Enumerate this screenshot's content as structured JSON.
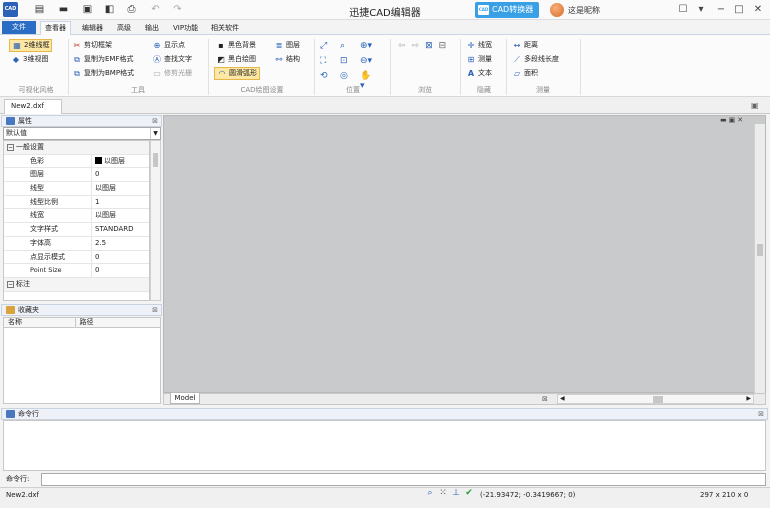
{
  "title_bar": {
    "logo_text": "CAD",
    "app_title": "迅捷CAD编辑器",
    "convert_button_label": "CAD转换器",
    "convert_icon_text": "CAD",
    "user_name": "这是昵称",
    "quick_access_icons": [
      "new-doc-icon",
      "open-folder-icon",
      "save-icon",
      "export-icon",
      "print-icon",
      "undo-icon",
      "redo-icon"
    ],
    "window_controls": [
      "feedback-icon",
      "skin-icon",
      "minimize-icon",
      "maximize-icon",
      "close-icon"
    ]
  },
  "menu": {
    "file": "文件",
    "tabs": [
      "查看器",
      "编辑器",
      "高级",
      "输出",
      "VIP功能",
      "相关软件"
    ],
    "active_tab": "查看器"
  },
  "ribbon": {
    "groups": [
      {
        "label": "可视化风格",
        "items": [
          "2维线框",
          "3维视图"
        ]
      },
      {
        "label": "工具",
        "items": [
          "剪切框架",
          "复制为EMF格式",
          "复制为BMP格式",
          "显示点",
          "查找文字",
          "修剪光栅"
        ]
      },
      {
        "label": "CAD绘图设置",
        "items": [
          "黑色背景",
          "黑白绘图",
          "圆滑弧形",
          "图层",
          "结构"
        ]
      },
      {
        "label": "位置",
        "items": []
      },
      {
        "label": "浏览",
        "items": []
      },
      {
        "label": "隐藏",
        "items": [
          "线宽",
          "测量",
          "文本"
        ]
      },
      {
        "label": "测量",
        "items": [
          "距离",
          "多段线长度",
          "面积"
        ]
      }
    ],
    "selected_items": [
      "2维线框",
      "圆滑弧形"
    ],
    "disabled_items": [
      "修剪光栅"
    ]
  },
  "document": {
    "tab_label": "New2.dxf",
    "model_tab": "Model"
  },
  "properties": {
    "panel_title": "属性",
    "selector_value": "默认值",
    "groups": [
      {
        "name": "一般设置",
        "rows": [
          {
            "key": "色彩",
            "value": "以图层"
          },
          {
            "key": "图层",
            "value": "0"
          },
          {
            "key": "线型",
            "value": "以图层"
          },
          {
            "key": "线型比例",
            "value": "1"
          },
          {
            "key": "线宽",
            "value": "以图层"
          },
          {
            "key": "文字样式",
            "value": "STANDARD"
          },
          {
            "key": "字体高",
            "value": "2.5"
          },
          {
            "key": "点显示模式",
            "value": "0"
          },
          {
            "key": "Point Size",
            "value": "0"
          }
        ]
      },
      {
        "name": "标注",
        "rows": []
      }
    ],
    "color_swatch": "#000000"
  },
  "favorites": {
    "panel_title": "收藏夹",
    "columns": [
      "名称",
      "路径"
    ]
  },
  "command": {
    "panel_title": "命令行",
    "input_label": "命令行:",
    "input_value": ""
  },
  "status": {
    "file": "New2.dxf",
    "coords": "(-21.93472; -0.3419667; 0)",
    "size": "297 x 210 x 0"
  },
  "colors": {
    "accent": "#2b6cc4",
    "convert_button": "#3aa0e6",
    "canvas": "#c9cacb",
    "selected": "#fde7a4"
  }
}
